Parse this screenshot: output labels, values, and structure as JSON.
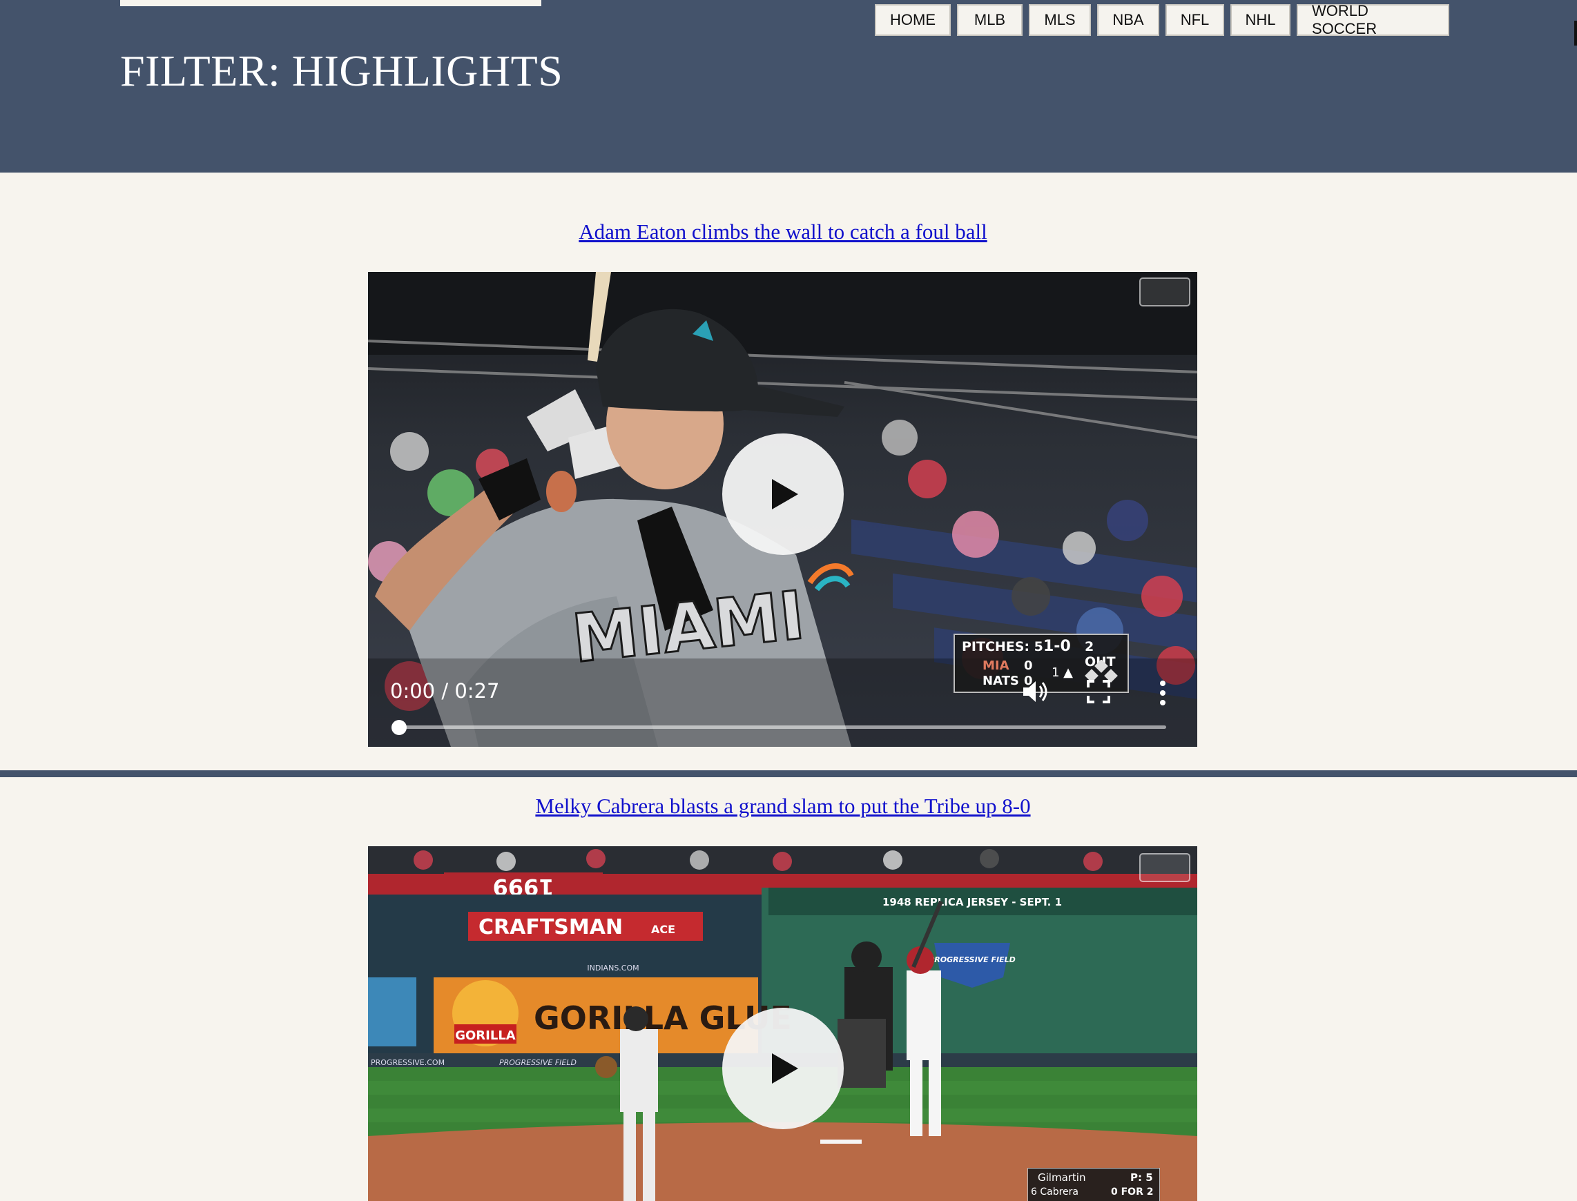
{
  "header": {
    "title": "FILTER: HIGHLIGHTS",
    "nav": [
      "HOME",
      "MLB",
      "MLS",
      "NBA",
      "NFL",
      "NHL",
      "WORLD SOCCER"
    ]
  },
  "posts": [
    {
      "title": "Adam Eaton climbs the wall to catch a foul ball",
      "time": "0:00 / 0:27",
      "jersey": "MIAMI",
      "scorebug": {
        "pitches": "PITCHES: 5",
        "count": "1-0",
        "outs": "2 OUT",
        "away": "MIA",
        "away_score": "0",
        "home": "NATS",
        "home_score": "0",
        "inning": "1 ▲"
      }
    },
    {
      "title": "Melky Cabrera blasts a grand slam to put the Tribe up 8-0",
      "signs": {
        "year": "1999",
        "banner": "1948 REPLICA JERSEY - SEPT. 1",
        "craftsman": "CRAFTSMAN",
        "ace": "ACE",
        "gorilla": "GORILLA GLUE",
        "gorilla_small": "GORILLA",
        "indians": "INDIANS.COM",
        "progressive": "PROGRESSIVE FIELD",
        "progressive_ad": "PROGRESSIVE.COM",
        "pitcher_label": "Gilmartin",
        "pitches": "P: 5",
        "batter_label": "6 Cabrera",
        "batter_stat": "0 FOR 2"
      }
    }
  ]
}
